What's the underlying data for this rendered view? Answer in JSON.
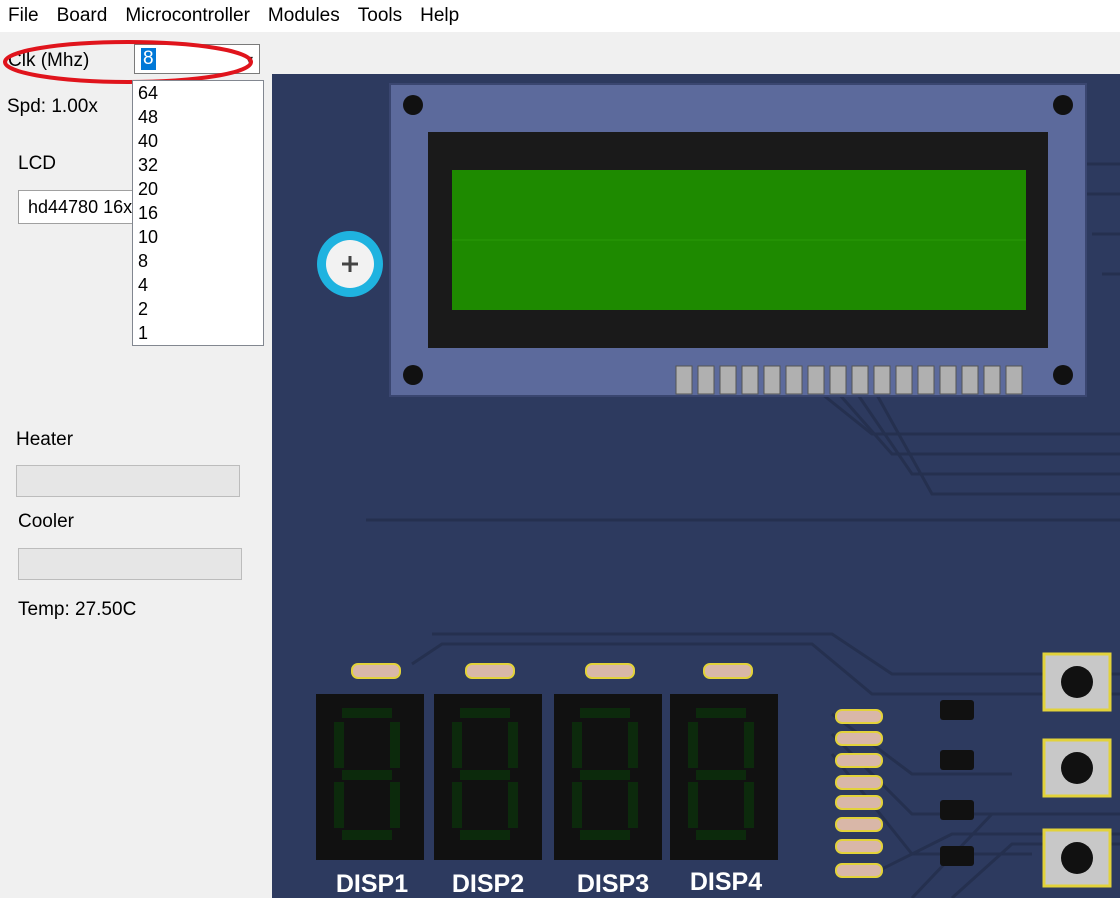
{
  "menu": [
    "File",
    "Board",
    "Microcontroller",
    "Modules",
    "Tools",
    "Help"
  ],
  "clk": {
    "label": "Clk (Mhz)",
    "value": "8",
    "options": [
      "64",
      "48",
      "40",
      "32",
      "20",
      "16",
      "10",
      "8",
      "4",
      "2",
      "1"
    ]
  },
  "speed": "Spd: 1.00x",
  "lcd": {
    "label": "LCD",
    "value": "hd44780 16x2"
  },
  "heater": {
    "label": "Heater"
  },
  "cooler": {
    "label": "Cooler"
  },
  "temp": "Temp: 27.50C",
  "board": {
    "displays": [
      "DISP1",
      "DISP2",
      "DISP3",
      "DISP4"
    ]
  },
  "colors": {
    "board_bg": "#2d3a5f",
    "lcd_frame": "#5c6a9c",
    "lcd_screen": "#1e8a00",
    "annotation": "#e0141c"
  }
}
